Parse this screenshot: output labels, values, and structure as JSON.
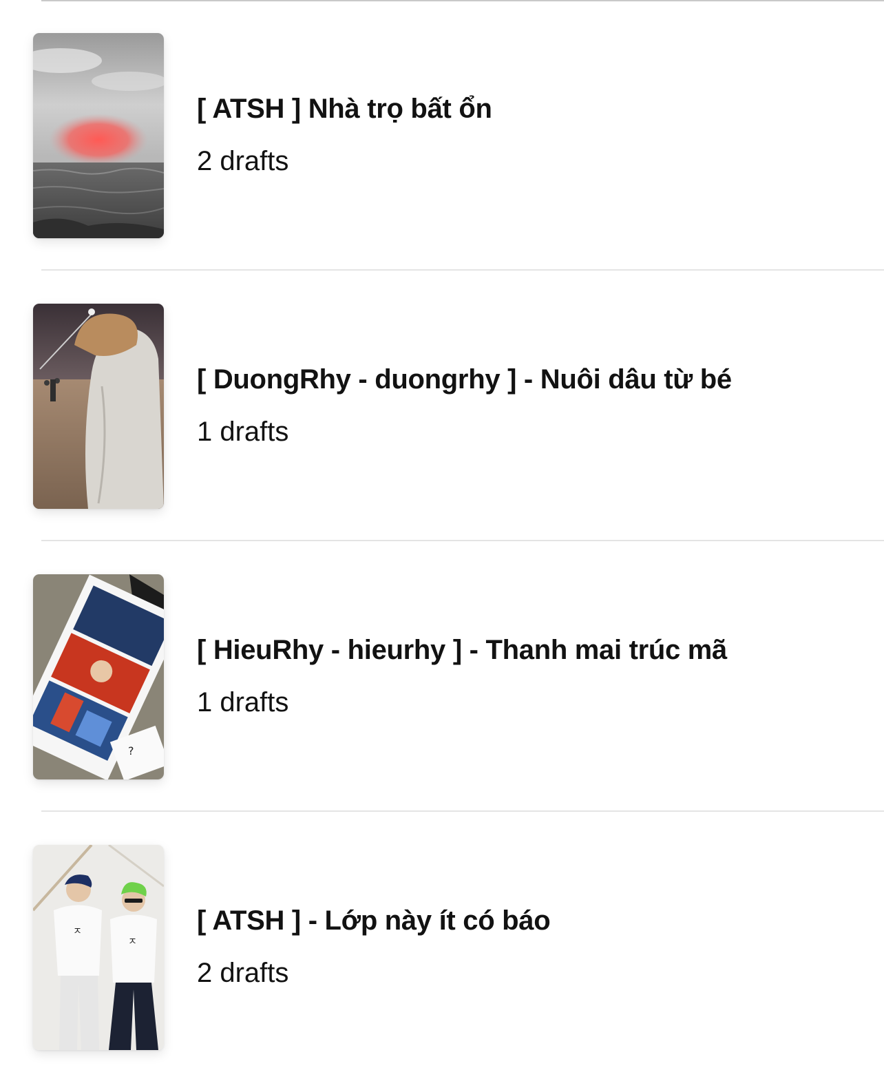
{
  "stories": [
    {
      "title": "[ ATSH ] Nhà trọ bất ổn",
      "drafts": "2 drafts",
      "cover_icon": "cover-image-sunset-sea"
    },
    {
      "title": "[ DuongRhy - duongrhy ] - Nuôi dâu từ bé",
      "drafts": "1 drafts",
      "cover_icon": "cover-image-beach-night"
    },
    {
      "title": "[ HieuRhy - hieurhy ] - Thanh mai trúc mã",
      "drafts": "1 drafts",
      "cover_icon": "cover-image-photo-strips"
    },
    {
      "title": "[ ATSH ] - Lớp này ít có báo",
      "drafts": "2 drafts",
      "cover_icon": "cover-image-two-people"
    }
  ],
  "colors": {
    "text": "#121212",
    "divider": "#e4e4e4",
    "background": "#ffffff"
  }
}
